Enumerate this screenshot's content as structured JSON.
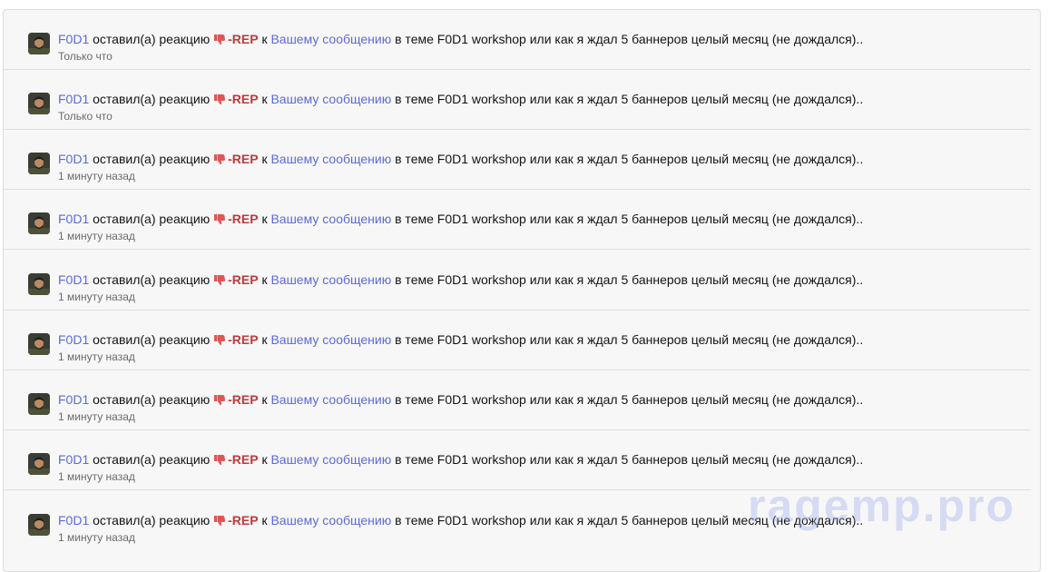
{
  "alerts": [
    {
      "username": "F0D1",
      "action": "оставил(а) реакцию",
      "reaction": "-REP",
      "preposition": "к",
      "target_link": "Вашему сообщению",
      "thread_text": "в теме F0D1 workshop или как я ждал 5 баннеров целый месяц (не дождался)..",
      "time": "Только что"
    },
    {
      "username": "F0D1",
      "action": "оставил(а) реакцию",
      "reaction": "-REP",
      "preposition": "к",
      "target_link": "Вашему сообщению",
      "thread_text": "в теме F0D1 workshop или как я ждал 5 баннеров целый месяц (не дождался)..",
      "time": "Только что"
    },
    {
      "username": "F0D1",
      "action": "оставил(а) реакцию",
      "reaction": "-REP",
      "preposition": "к",
      "target_link": "Вашему сообщению",
      "thread_text": "в теме F0D1 workshop или как я ждал 5 баннеров целый месяц (не дождался)..",
      "time": "1 минуту назад"
    },
    {
      "username": "F0D1",
      "action": "оставил(а) реакцию",
      "reaction": "-REP",
      "preposition": "к",
      "target_link": "Вашему сообщению",
      "thread_text": "в теме F0D1 workshop или как я ждал 5 баннеров целый месяц (не дождался)..",
      "time": "1 минуту назад"
    },
    {
      "username": "F0D1",
      "action": "оставил(а) реакцию",
      "reaction": "-REP",
      "preposition": "к",
      "target_link": "Вашему сообщению",
      "thread_text": "в теме F0D1 workshop или как я ждал 5 баннеров целый месяц (не дождался)..",
      "time": "1 минуту назад"
    },
    {
      "username": "F0D1",
      "action": "оставил(а) реакцию",
      "reaction": "-REP",
      "preposition": "к",
      "target_link": "Вашему сообщению",
      "thread_text": "в теме F0D1 workshop или как я ждал 5 баннеров целый месяц (не дождался)..",
      "time": "1 минуту назад"
    },
    {
      "username": "F0D1",
      "action": "оставил(а) реакцию",
      "reaction": "-REP",
      "preposition": "к",
      "target_link": "Вашему сообщению",
      "thread_text": "в теме F0D1 workshop или как я ждал 5 баннеров целый месяц (не дождался)..",
      "time": "1 минуту назад"
    },
    {
      "username": "F0D1",
      "action": "оставил(а) реакцию",
      "reaction": "-REP",
      "preposition": "к",
      "target_link": "Вашему сообщению",
      "thread_text": "в теме F0D1 workshop или как я ждал 5 баннеров целый месяц (не дождался)..",
      "time": "1 минуту назад"
    },
    {
      "username": "F0D1",
      "action": "оставил(а) реакцию",
      "reaction": "-REP",
      "preposition": "к",
      "target_link": "Вашему сообщению",
      "thread_text": "в теме F0D1 workshop или как я ждал 5 баннеров целый месяц (не дождался)..",
      "time": "1 минуту назад"
    }
  ],
  "reaction_icon": "thumbs-down-icon",
  "colors": {
    "link": "#5c6bd6",
    "reaction": "#c03a3a",
    "thumb": "#e05656"
  },
  "watermark": "ragemp.pro"
}
